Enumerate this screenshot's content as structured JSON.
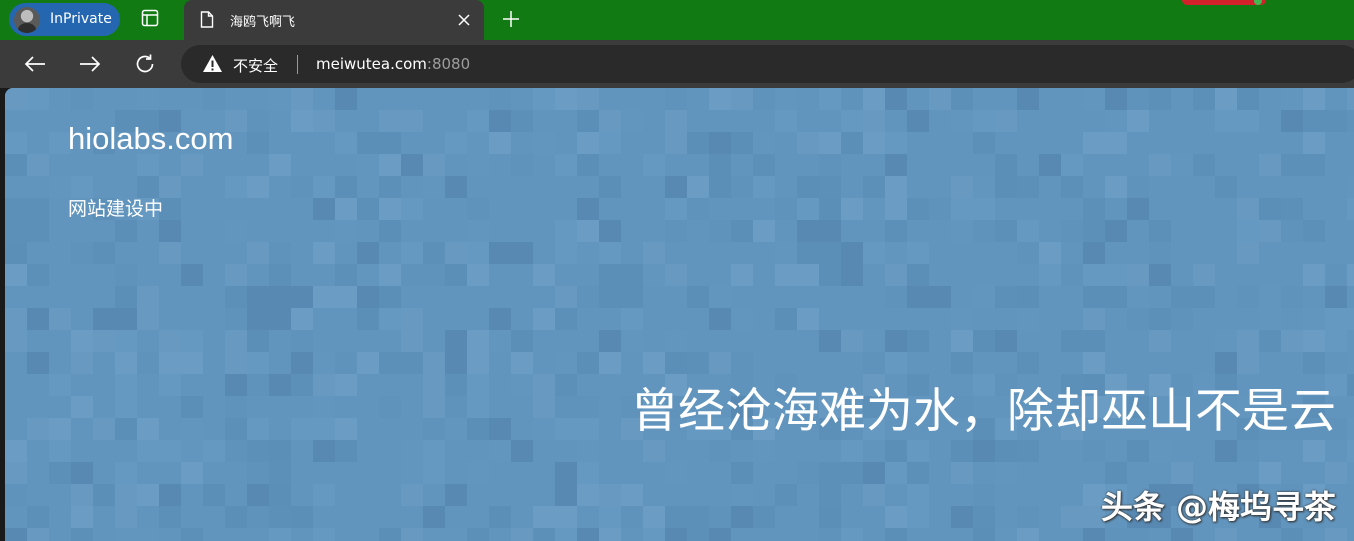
{
  "browser": {
    "profile_label": "InPrivate",
    "tab": {
      "title": "海鸥飞啊飞"
    },
    "address": {
      "security_label": "不安全",
      "url_host": "meiwutea.com",
      "url_port": ":8080"
    }
  },
  "page": {
    "site_title": "hiolabs.com",
    "status_text": "网站建设中",
    "quote": "曾经沧海难为水，除却巫山不是云",
    "watermark": "头条 @梅坞寻茶"
  },
  "colors": {
    "tabbar_bg": "#117a12",
    "toolbar_bg": "#3b3b3b",
    "profile_pill": "#2566b0",
    "page_bg": "#6295bd"
  },
  "icons": [
    "workspaces-icon",
    "page-icon",
    "close-icon",
    "plus-icon",
    "back-arrow-icon",
    "forward-arrow-icon",
    "refresh-icon",
    "warning-icon"
  ]
}
